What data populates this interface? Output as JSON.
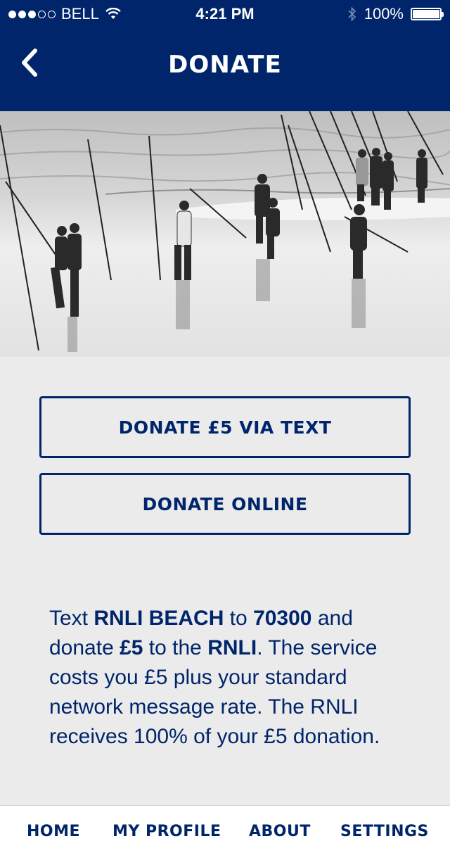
{
  "status_bar": {
    "carrier": "BELL",
    "time": "4:21 PM",
    "battery": "100%",
    "signal_bars_filled": 3,
    "signal_bars_total": 5
  },
  "nav": {
    "title": "DONATE",
    "back_icon": "chevron-left-icon"
  },
  "hero": {
    "icon": "photo-fishermen-beach"
  },
  "buttons": {
    "donate_text": "DONATE £5 VIA TEXT",
    "donate_online": "DONATE ONLINE"
  },
  "info": {
    "p1": "Text ",
    "b1": "RNLI BEACH",
    "p2": " to ",
    "b2": "70300",
    "p3": " and donate ",
    "b3": "£5",
    "p4": " to the ",
    "b4": "RNLI",
    "p5": ". The service costs you £5 plus your standard network message rate. The RNLI receives 100% of your £5 donation."
  },
  "tabs": {
    "home": "HOME",
    "profile": "MY PROFILE",
    "about": "ABOUT",
    "settings": "SETTINGS"
  },
  "colors": {
    "brand_navy": "#00256b",
    "background": "#ebebeb",
    "tabbar": "#ffffff"
  }
}
